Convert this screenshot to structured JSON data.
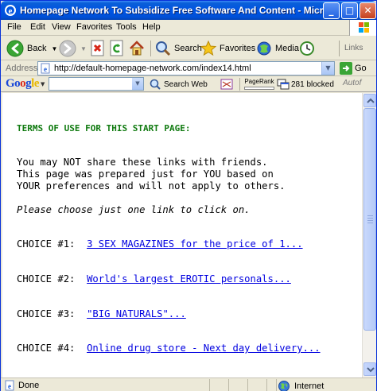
{
  "window": {
    "title": "Homepage Network To Subsidize Free Software And Content - Microsoft Inte...",
    "controls": {
      "minimize": "_",
      "maximize": "□",
      "close": "✕"
    }
  },
  "menubar": {
    "items": [
      "File",
      "Edit",
      "View",
      "Favorites",
      "Tools",
      "Help"
    ]
  },
  "toolbar": {
    "back_label": "Back",
    "search_label": "Search",
    "favorites_label": "Favorites",
    "media_label": "Media",
    "links_label": "Links"
  },
  "addressbar": {
    "label": "Address",
    "url": "http://default-homepage-network.com/index14.html",
    "go_label": "Go"
  },
  "googlebar": {
    "logo": {
      "g1": "Go",
      "g2": "o",
      "g3": "g",
      "g4": "le"
    },
    "search_web_label": "Search Web",
    "pagerank_label": "PageRank",
    "blocked_label": "281 blocked",
    "autofill_label": "Autof"
  },
  "content": {
    "terms_heading": "TERMS OF USE FOR THIS START PAGE:",
    "paragraph_lines": [
      "You may NOT share these links with friends.",
      "This page was prepared just for YOU based on",
      "YOUR preferences and will not apply to others."
    ],
    "instruction": "Please choose just one link to click on.",
    "choices": [
      {
        "label": "CHOICE #1:",
        "link": "3 SEX MAGAZINES for the price of 1..."
      },
      {
        "label": "CHOICE #2:",
        "link": "World's largest EROTIC personals..."
      },
      {
        "label": "CHOICE #3:",
        "link": "\"BIG NATURALS\"..."
      },
      {
        "label": "CHOICE #4:",
        "link": "Online drug store - Next day delivery..."
      }
    ]
  },
  "statusbar": {
    "status_text": "Done",
    "zone_text": "Internet"
  },
  "colors": {
    "terms_heading": "#0f7a0f",
    "link": "#0000e0",
    "titlebar": "#0054e3"
  }
}
